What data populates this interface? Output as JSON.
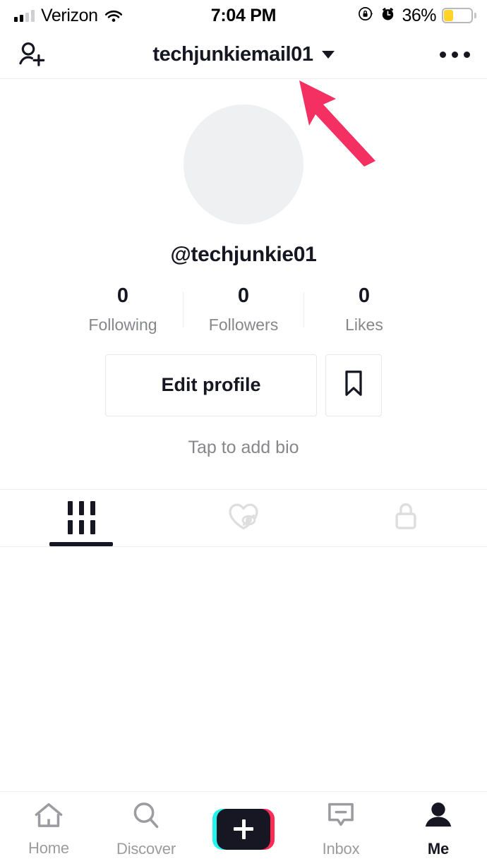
{
  "status_bar": {
    "carrier": "Verizon",
    "signal_bars_total": 4,
    "signal_bars_active": 2,
    "wifi_icon": "wifi-icon",
    "time": "7:04 PM",
    "rotation_lock_icon": "rotation-lock-icon",
    "alarm_icon": "alarm-clock-icon",
    "battery_percent": "36%",
    "battery_level": 36,
    "battery_color": "#ffd426"
  },
  "header": {
    "add_friends_icon": "add-friend-icon",
    "title": "techjunkiemail01",
    "dropdown_icon": "chevron-down-icon",
    "more_icon": "more-options-icon"
  },
  "profile": {
    "avatar_icon": "avatar-placeholder",
    "avatar_color": "#eff0f1",
    "handle": "@techjunkie01",
    "stats": [
      {
        "count": "0",
        "label": "Following"
      },
      {
        "count": "0",
        "label": "Followers"
      },
      {
        "count": "0",
        "label": "Likes"
      }
    ],
    "edit_profile_label": "Edit profile",
    "bookmark_icon": "bookmark-icon",
    "bio_placeholder": "Tap to add bio"
  },
  "tabs": [
    {
      "name": "videos",
      "icon": "grid-icon",
      "active": true
    },
    {
      "name": "liked",
      "icon": "heart-hidden-icon",
      "active": false
    },
    {
      "name": "private",
      "icon": "lock-icon",
      "active": false
    }
  ],
  "bottom_nav": [
    {
      "label": "Home",
      "icon": "home-icon",
      "active": false
    },
    {
      "label": "Discover",
      "icon": "search-icon",
      "active": false
    },
    {
      "label": "",
      "icon": "create-icon",
      "active": false
    },
    {
      "label": "Inbox",
      "icon": "inbox-icon",
      "active": false
    },
    {
      "label": "Me",
      "icon": "person-icon",
      "active": true
    }
  ],
  "annotation": {
    "arrow_icon": "annotation-arrow",
    "arrow_color": "#f42f61"
  }
}
